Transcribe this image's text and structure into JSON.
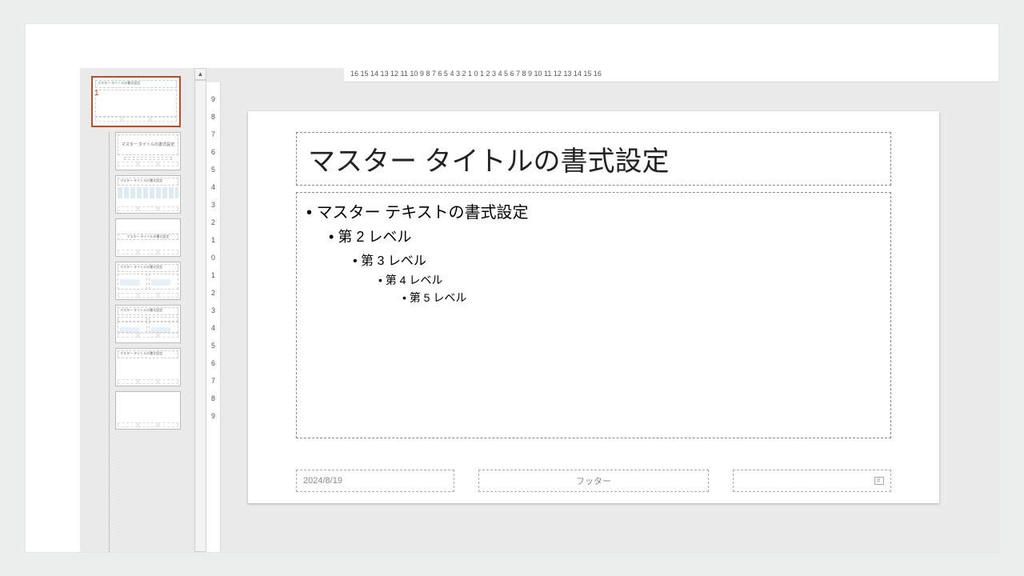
{
  "thumbnails": {
    "master_index": "1",
    "master_title_text": "マスター タイトルの書式設定",
    "layouts_title_text": "マスター タイトルの書式設定"
  },
  "ruler_h": "16  15  14  13  12  11  10  9  8  7  6  5  4  3  2  1  0  1  2  3  4  5  6  7  8  9  10  11  12  13  14  15  16",
  "ruler_v": [
    "9",
    "8",
    "7",
    "6",
    "5",
    "4",
    "3",
    "2",
    "1",
    "0",
    "1",
    "2",
    "3",
    "4",
    "5",
    "6",
    "7",
    "8",
    "9"
  ],
  "slide": {
    "title": "マスター タイトルの書式設定",
    "levels": {
      "l1": "マスター テキストの書式設定",
      "l2": "第 2 レベル",
      "l3": "第 3 レベル",
      "l4": "第 4 レベル",
      "l5": "第 5 レベル"
    },
    "date": "2024/8/19",
    "footer": "フッター"
  }
}
